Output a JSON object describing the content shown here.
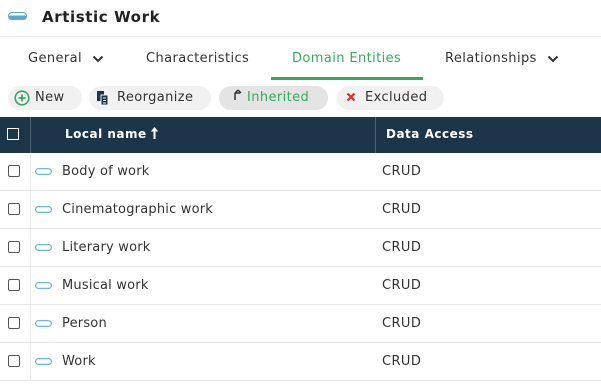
{
  "window": {
    "title": "Artistic Work",
    "icon": "entity-pill-icon"
  },
  "tabs": [
    {
      "label": "General",
      "has_dropdown": true,
      "active": false
    },
    {
      "label": "Characteristics",
      "has_dropdown": false,
      "active": false
    },
    {
      "label": "Domain Entities",
      "has_dropdown": false,
      "active": true
    },
    {
      "label": "Relationships",
      "has_dropdown": true,
      "active": false
    }
  ],
  "toolbar": {
    "new_label": "New",
    "reorganize_label": "Reorganize",
    "inherited_label": "Inherited",
    "excluded_label": "Excluded"
  },
  "table": {
    "columns": {
      "name": "Local name",
      "access": "Data Access"
    },
    "sort": "ascending",
    "rows": [
      {
        "name": "Body of work",
        "access": "CRUD"
      },
      {
        "name": "Cinematographic work",
        "access": "CRUD"
      },
      {
        "name": "Literary work",
        "access": "CRUD"
      },
      {
        "name": "Musical work",
        "access": "CRUD"
      },
      {
        "name": "Person",
        "access": "CRUD"
      },
      {
        "name": "Work",
        "access": "CRUD"
      }
    ]
  },
  "colors": {
    "accent_green": "#3aa660",
    "header_bg": "#1d3549",
    "entity_icon": "#6fb8cf",
    "excluded_red": "#d9312b"
  }
}
